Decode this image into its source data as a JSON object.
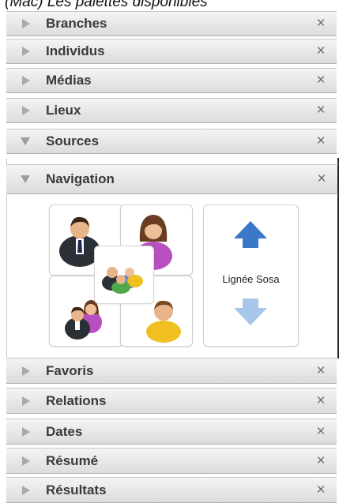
{
  "caption": "(Mac) Les palettes disponibles",
  "top_palettes": [
    {
      "label": "Branches",
      "expanded": false
    },
    {
      "label": "Individus",
      "expanded": false
    },
    {
      "label": "Médias",
      "expanded": false
    },
    {
      "label": "Lieux",
      "expanded": false
    },
    {
      "label": "Sources",
      "expanded": true
    }
  ],
  "navigation": {
    "title": "Navigation",
    "sosa_label": "Lignée Sosa"
  },
  "bottom_palettes": [
    {
      "label": "Favoris"
    },
    {
      "label": "Relations"
    },
    {
      "label": "Dates"
    },
    {
      "label": "Résumé"
    },
    {
      "label": "Résultats"
    }
  ],
  "close_glyph": "×",
  "colors": {
    "arrow_up": "#3a79c8",
    "arrow_down": "#a8c6ea",
    "female_dress": "#b84fc0",
    "child_shirt": "#f0c020"
  }
}
